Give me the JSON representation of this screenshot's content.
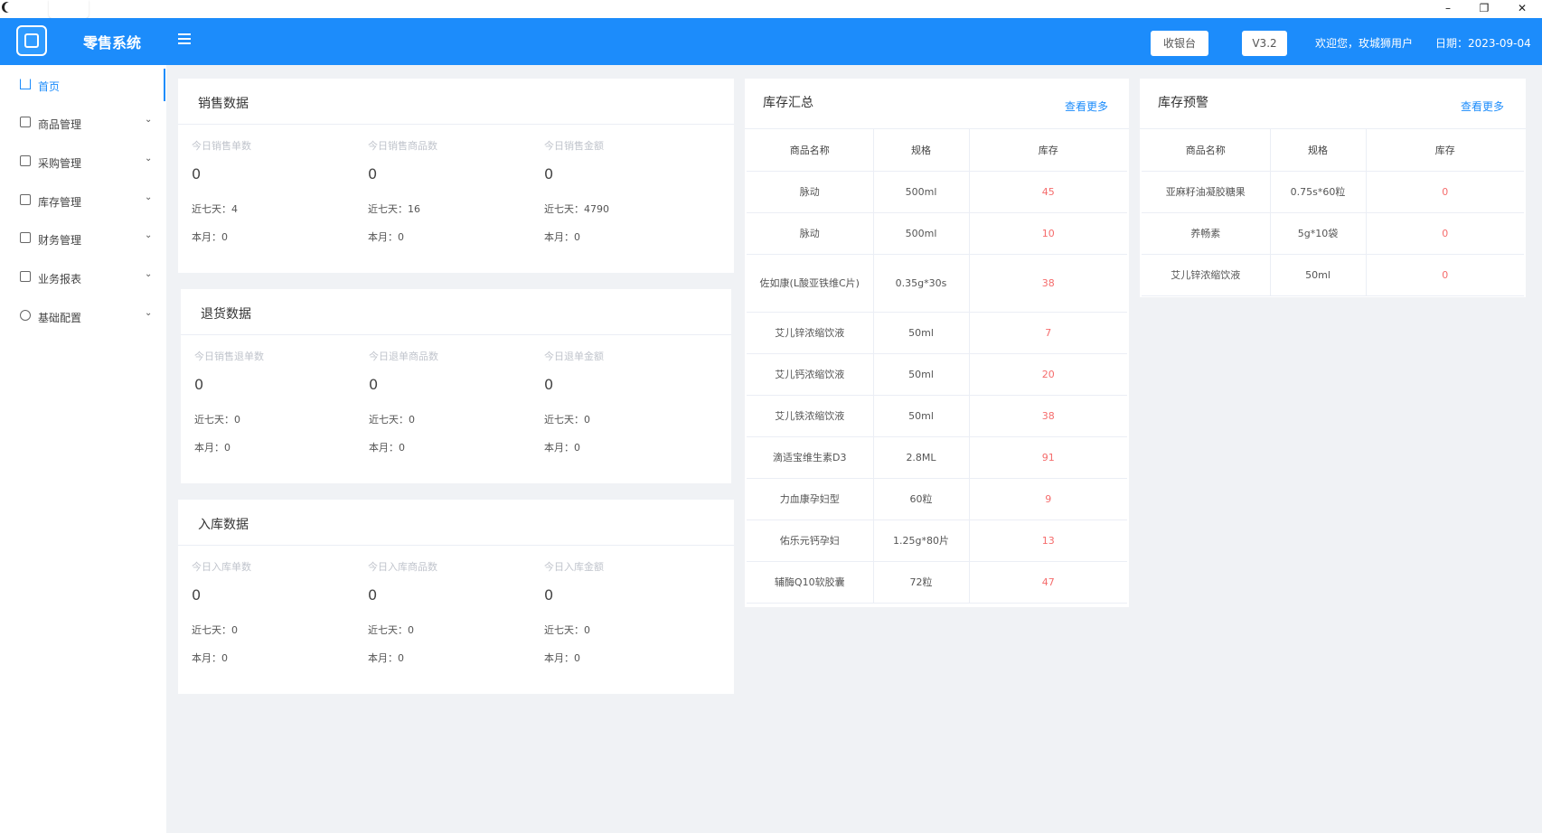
{
  "app": {
    "title": "零售系统",
    "cashier_button": "收银台",
    "version_button": "V3.2",
    "welcome": "欢迎您，玫城狮用户",
    "date": "日期：2023-09-04"
  },
  "window": {
    "minimize": "–",
    "restore": "❐",
    "close": "✕"
  },
  "sidebar": {
    "items": [
      {
        "label": "首页",
        "icon": "home-icon"
      },
      {
        "label": "商品管理",
        "icon": "goods-icon"
      },
      {
        "label": "采购管理",
        "icon": "cart-icon"
      },
      {
        "label": "库存管理",
        "icon": "inventory-icon"
      },
      {
        "label": "财务管理",
        "icon": "finance-icon"
      },
      {
        "label": "业务报表",
        "icon": "report-icon"
      },
      {
        "label": "基础配置",
        "icon": "gear-icon"
      }
    ]
  },
  "sales": {
    "title": "销售数据",
    "cols": [
      {
        "label": "今日销售单数",
        "value": "0",
        "week": "近七天：4",
        "month": "本月：0"
      },
      {
        "label": "今日销售商品数",
        "value": "0",
        "week": "近七天：16",
        "month": "本月：0"
      },
      {
        "label": "今日销售金额",
        "value": "0",
        "week": "近七天：4790",
        "month": "本月：0"
      }
    ]
  },
  "returns": {
    "title": "退货数据",
    "cols": [
      {
        "label": "今日销售退单数",
        "value": "0",
        "week": "近七天：0",
        "month": "本月：0"
      },
      {
        "label": "今日退单商品数",
        "value": "0",
        "week": "近七天：0",
        "month": "本月：0"
      },
      {
        "label": "今日退单金额",
        "value": "0",
        "week": "近七天：0",
        "month": "本月：0"
      }
    ]
  },
  "inbound": {
    "title": "入库数据",
    "cols": [
      {
        "label": "今日入库单数",
        "value": "0",
        "week": "近七天：0",
        "month": "本月：0"
      },
      {
        "label": "今日入库商品数",
        "value": "0",
        "week": "近七天：0",
        "month": "本月：0"
      },
      {
        "label": "今日入库金额",
        "value": "0",
        "week": "近七天：0",
        "month": "本月：0"
      }
    ]
  },
  "stock_summary": {
    "title": "库存汇总",
    "more": "查看更多",
    "headers": [
      "商品名称",
      "规格",
      "库存"
    ],
    "rows": [
      [
        "脉动",
        "500ml",
        "45"
      ],
      [
        "脉动",
        "500ml",
        "10"
      ],
      [
        "佐如康(L酸亚铁维C片)",
        "0.35g*30s",
        "38"
      ],
      [
        "艾儿锌浓缩饮液",
        "50ml",
        "7"
      ],
      [
        "艾儿钙浓缩饮液",
        "50ml",
        "20"
      ],
      [
        "艾儿铁浓缩饮液",
        "50ml",
        "38"
      ],
      [
        "滴适宝维生素D3",
        "2.8ML",
        "91"
      ],
      [
        "力血康孕妇型",
        "60粒",
        "9"
      ],
      [
        "佑乐元钙孕妇",
        "1.25g*80片",
        "13"
      ],
      [
        "辅酶Q10软胶囊",
        "72粒",
        "47"
      ]
    ]
  },
  "stock_alert": {
    "title": "库存预警",
    "more": "查看更多",
    "headers": [
      "商品名称",
      "规格",
      "库存"
    ],
    "rows": [
      [
        "亚麻籽油凝胶糖果",
        "0.75s*60粒",
        "0"
      ],
      [
        "养畅素",
        "5g*10袋",
        "0"
      ],
      [
        "艾儿锌浓缩饮液",
        "50ml",
        "0"
      ]
    ]
  },
  "colors": {
    "primary": "#1c8cfb",
    "alert": "#f56c6c",
    "background": "#f0f2f5"
  }
}
